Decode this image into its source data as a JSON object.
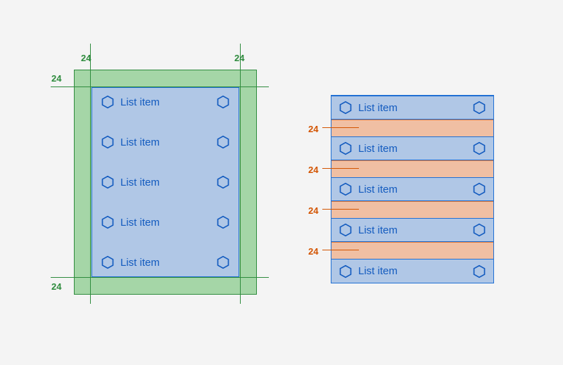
{
  "left_panel": {
    "padding": 24,
    "dim_top_left": "24",
    "dim_top_right": "24",
    "dim_left_top": "24",
    "dim_left_bottom": "24",
    "items": [
      {
        "label": "List item"
      },
      {
        "label": "List item"
      },
      {
        "label": "List item"
      },
      {
        "label": "List item"
      },
      {
        "label": "List item"
      }
    ]
  },
  "right_panel": {
    "gap": 24,
    "dims": [
      "24",
      "24",
      "24",
      "24"
    ],
    "items": [
      {
        "label": "List item"
      },
      {
        "label": "List item"
      },
      {
        "label": "List item"
      },
      {
        "label": "List item"
      },
      {
        "label": "List item"
      }
    ]
  }
}
